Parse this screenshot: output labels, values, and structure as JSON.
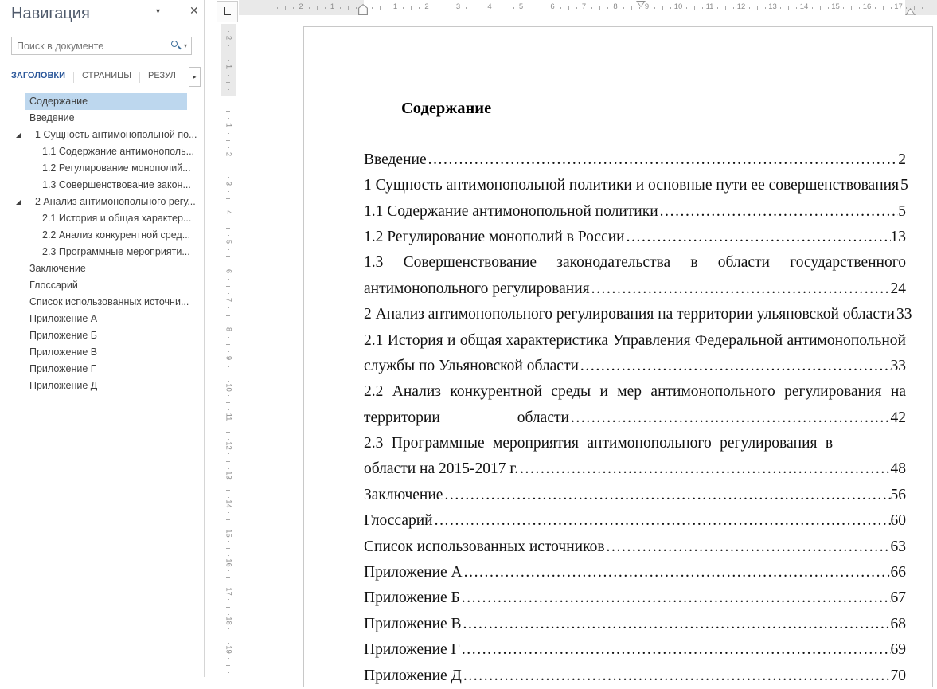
{
  "navigation": {
    "title": "Навигация",
    "pane_menu_icon": "▾",
    "close_icon": "✕",
    "search": {
      "placeholder": "Поиск в документе",
      "dropdown_icon": "▾"
    },
    "tabs": [
      {
        "label": "ЗАГОЛОВКИ",
        "active": true
      },
      {
        "label": "СТРАНИЦЫ",
        "active": false
      },
      {
        "label": "РЕЗУЛ",
        "active": false
      }
    ],
    "tabs_overflow_icon": "▸",
    "items": [
      {
        "label": "Содержание",
        "level": 0,
        "selected": true,
        "expanded": false
      },
      {
        "label": "Введение",
        "level": 0,
        "selected": false,
        "expanded": false
      },
      {
        "label": "1 Сущность антимонопольной по...",
        "level": 0,
        "selected": false,
        "expanded": true
      },
      {
        "label": "1.1 Содержание антимонополь...",
        "level": 1,
        "selected": false,
        "expanded": false
      },
      {
        "label": "1.2 Регулирование монополий...",
        "level": 1,
        "selected": false,
        "expanded": false
      },
      {
        "label": "1.3 Совершенствование закон...",
        "level": 1,
        "selected": false,
        "expanded": false
      },
      {
        "label": "2 Анализ антимонопольного регу...",
        "level": 0,
        "selected": false,
        "expanded": true
      },
      {
        "label": "2.1 История и общая характер...",
        "level": 1,
        "selected": false,
        "expanded": false
      },
      {
        "label": "2.2 Анализ конкурентной сред...",
        "level": 1,
        "selected": false,
        "expanded": false
      },
      {
        "label": "2.3 Программные мероприяти...",
        "level": 1,
        "selected": false,
        "expanded": false
      },
      {
        "label": "Заключение",
        "level": 0,
        "selected": false,
        "expanded": false
      },
      {
        "label": "Глоссарий",
        "level": 0,
        "selected": false,
        "expanded": false
      },
      {
        "label": "Список использованных источни...",
        "level": 0,
        "selected": false,
        "expanded": false
      },
      {
        "label": "Приложение А",
        "level": 0,
        "selected": false,
        "expanded": false
      },
      {
        "label": "Приложение Б",
        "level": 0,
        "selected": false,
        "expanded": false
      },
      {
        "label": "Приложение В",
        "level": 0,
        "selected": false,
        "expanded": false
      },
      {
        "label": "Приложение Г",
        "level": 0,
        "selected": false,
        "expanded": false
      },
      {
        "label": "Приложение Д",
        "level": 0,
        "selected": false,
        "expanded": false
      }
    ]
  },
  "document": {
    "title": "Содержание",
    "toc": [
      {
        "mode": "leader",
        "text": "Введение",
        "page": "2"
      },
      {
        "mode": "leader",
        "text": "1 Сущность антимонопольной политики и основные пути ее совершенствования",
        "page": "5"
      },
      {
        "mode": "leader",
        "text": "1.1 Содержание антимонопольной политики",
        "page": "5"
      },
      {
        "mode": "leader",
        "text": "1.2 Регулирование монополий в России",
        "page": "13"
      },
      {
        "mode": "justify",
        "text": "1.3 Совершенствование законодательства в области государственного"
      },
      {
        "mode": "leader",
        "text": "антимонопольного регулирования",
        "page": "24"
      },
      {
        "mode": "leader",
        "text": "2 Анализ антимонопольного регулирования на территории ульяновской области",
        "page": "33"
      },
      {
        "mode": "justify",
        "text": "2.1 История и общая характеристика Управления Федеральной антимонопольной"
      },
      {
        "mode": "leader",
        "text": "службы по Ульяновской области",
        "page": "33"
      },
      {
        "mode": "justify",
        "text": "2.2 Анализ конкурентной среды и мер антимонопольного регулирования на"
      },
      {
        "mode": "split",
        "text": "территории",
        "text2": "области",
        "page": "42"
      },
      {
        "mode": "spread",
        "text": "2.3 Программные мероприятия антимонопольного регулирования в"
      },
      {
        "mode": "leader",
        "text": "области на 2015-2017 г.",
        "page": "48"
      },
      {
        "mode": "leader",
        "text": "Заключение",
        "page": "56"
      },
      {
        "mode": "leader",
        "text": "Глоссарий",
        "page": "60"
      },
      {
        "mode": "leader",
        "text": "Список использованных источников",
        "page": "63"
      },
      {
        "mode": "leader",
        "text": "Приложение А",
        "page": "66"
      },
      {
        "mode": "leader",
        "text": "Приложение Б",
        "page": "67"
      },
      {
        "mode": "leader",
        "text": "Приложение В",
        "page": "68"
      },
      {
        "mode": "leader",
        "text": "Приложение Г",
        "page": "69"
      },
      {
        "mode": "leader",
        "text": "Приложение Д",
        "page": "70"
      }
    ]
  },
  "rulers": {
    "horizontal": {
      "margin_labels": [
        "1",
        "2"
      ],
      "labels": [
        "1",
        "2",
        "3",
        "4",
        "5",
        "6",
        "7",
        "8",
        "9",
        "10",
        "11",
        "12",
        "13",
        "14",
        "15",
        "16",
        "17"
      ]
    },
    "vertical": {
      "margin_labels": [
        "1",
        "2"
      ],
      "labels": [
        "1",
        "2",
        "3",
        "4",
        "5",
        "6",
        "7",
        "8",
        "9",
        "10",
        "11",
        "12",
        "13",
        "14",
        "15",
        "16",
        "17",
        "18",
        "19"
      ]
    }
  },
  "colors": {
    "accent": "#2b579a",
    "selection": "#bdd7ee",
    "ruler_gray": "#e9e9e9"
  }
}
